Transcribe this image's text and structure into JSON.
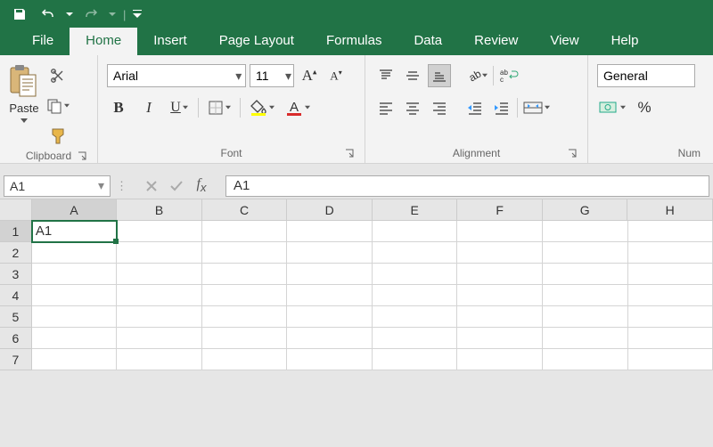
{
  "qat": {
    "save": "",
    "undo": "",
    "redo": ""
  },
  "tabs": {
    "file": "File",
    "home": "Home",
    "insert": "Insert",
    "pagelayout": "Page Layout",
    "formulas": "Formulas",
    "data": "Data",
    "review": "Review",
    "view": "View",
    "help": "Help"
  },
  "ribbon": {
    "clipboard": {
      "label": "Clipboard",
      "paste": "Paste"
    },
    "font": {
      "label": "Font",
      "name": "Arial",
      "size": "11"
    },
    "alignment": {
      "label": "Alignment"
    },
    "number": {
      "label": "Num",
      "format": "General"
    }
  },
  "formula_bar": {
    "namebox": "A1",
    "formula": "A1"
  },
  "grid": {
    "columns": [
      "A",
      "B",
      "C",
      "D",
      "E",
      "F",
      "G",
      "H"
    ],
    "rows": [
      "1",
      "2",
      "3",
      "4",
      "5",
      "6",
      "7"
    ],
    "active": "A1",
    "cells": {
      "A1": "A1"
    }
  }
}
